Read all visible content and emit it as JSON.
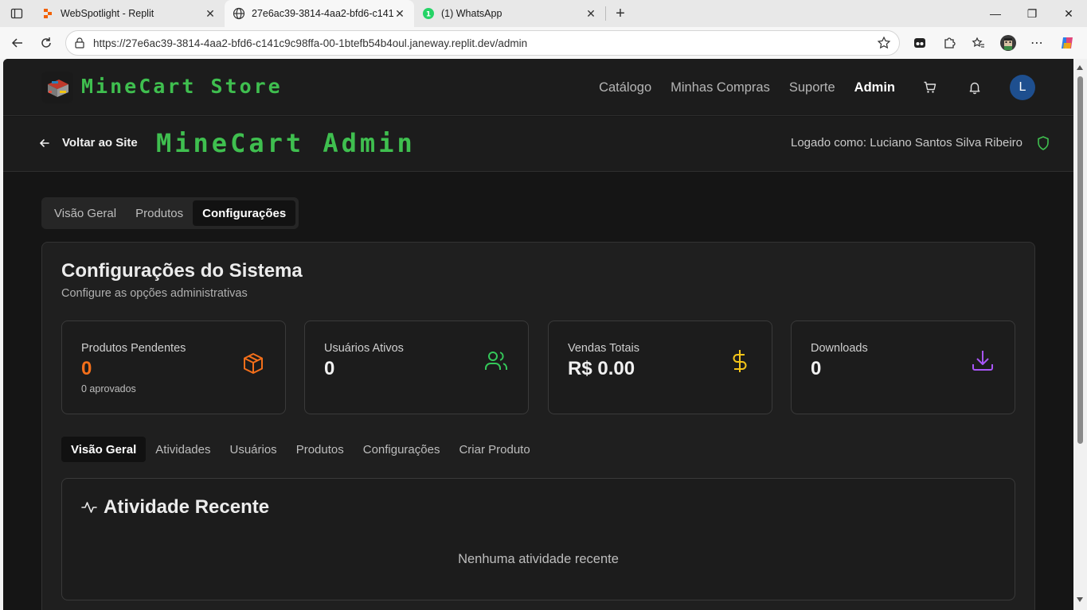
{
  "browser": {
    "tabs": [
      {
        "title": "WebSpotlight - Replit",
        "favicon": "replit-icon"
      },
      {
        "title": "27e6ac39-3814-4aa2-bfd6-c141c",
        "favicon": "globe-icon"
      },
      {
        "title": "(1) WhatsApp",
        "favicon": "whatsapp-icon"
      }
    ],
    "url": "https://27e6ac39-3814-4aa2-bfd6-c141c9c98ffa-00-1btefb54b4oul.janeway.replit.dev/admin"
  },
  "site": {
    "brand": "MineCart Store",
    "nav": [
      "Catálogo",
      "Minhas Compras",
      "Suporte",
      "Admin"
    ],
    "avatar_initial": "L"
  },
  "admin": {
    "back_label": "Voltar ao Site",
    "title": "MineCart Admin",
    "logged_as": "Logado como: Luciano Santos Silva Ribeiro"
  },
  "main_tabs": [
    "Visão Geral",
    "Produtos",
    "Configurações"
  ],
  "settings": {
    "title": "Configurações do Sistema",
    "subtitle": "Configure as opções administrativas"
  },
  "stats": [
    {
      "label": "Produtos Pendentes",
      "value": "0",
      "note": "0 aprovados",
      "icon": "package-icon",
      "color": "#f36f1a"
    },
    {
      "label": "Usuários Ativos",
      "value": "0",
      "icon": "users-icon",
      "color": "#34c759"
    },
    {
      "label": "Vendas Totais",
      "value": "R$ 0.00",
      "icon": "dollar-icon",
      "color": "#f5c518"
    },
    {
      "label": "Downloads",
      "value": "0",
      "icon": "download-icon",
      "color": "#a855f7"
    }
  ],
  "sub_tabs": [
    "Visão Geral",
    "Atividades",
    "Usuários",
    "Produtos",
    "Configurações",
    "Criar Produto"
  ],
  "activity": {
    "title": "Atividade Recente",
    "empty": "Nenhuma atividade recente"
  },
  "colors": {
    "accent_green": "#3fbf4f",
    "avatar_blue": "#1e4f8f"
  }
}
